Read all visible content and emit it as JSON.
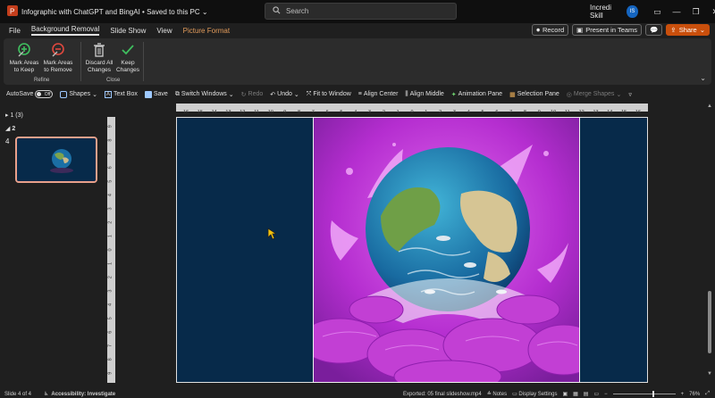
{
  "titlebar": {
    "doc_title": "Infographic with ChatGPT and BingAI",
    "save_state": "Saved to this PC",
    "search_placeholder": "Search",
    "user_name": "Incredi Skill",
    "user_initials": "IS"
  },
  "tabs": [
    {
      "label": "File"
    },
    {
      "label": "Background Removal"
    },
    {
      "label": "Slide Show"
    },
    {
      "label": "View"
    },
    {
      "label": "Picture Format"
    }
  ],
  "tab_actions": {
    "record": "Record",
    "present": "Present in Teams",
    "share": "Share"
  },
  "ribbon": {
    "mark_keep": "Mark Areas to Keep",
    "mark_remove": "Mark Areas to Remove",
    "refine_label": "Refine",
    "discard": "Discard All Changes",
    "keep_changes": "Keep Changes",
    "close_label": "Close"
  },
  "qat": {
    "autosave": "AutoSave",
    "autosave_state": "Off",
    "shapes": "Shapes",
    "text_box": "Text Box",
    "save": "Save",
    "switch_windows": "Switch Windows",
    "redo": "Redo",
    "undo": "Undo",
    "fit_window": "Fit to Window",
    "align_center": "Align Center",
    "align_middle": "Align Middle",
    "animation_pane": "Animation Pane",
    "selection_pane": "Selection Pane",
    "merge_shapes": "Merge Shapes"
  },
  "outline": {
    "section1": "1 (3)",
    "section2": "2",
    "thumb_number": "4"
  },
  "ruler": {
    "h_ticks": [
      "16",
      "15",
      "14",
      "13",
      "12",
      "11",
      "10",
      "9",
      "8",
      "7",
      "6",
      "5",
      "4",
      "3",
      "2",
      "1",
      "0",
      "1",
      "2",
      "3",
      "4",
      "5",
      "6",
      "7",
      "8",
      "9",
      "10",
      "11",
      "12",
      "13",
      "14",
      "15",
      "16"
    ],
    "v_ticks": [
      "9",
      "8",
      "7",
      "6",
      "5",
      "4",
      "3",
      "2",
      "1",
      "0",
      "1",
      "2",
      "3",
      "4",
      "5",
      "6",
      "7",
      "8",
      "9"
    ]
  },
  "status": {
    "slide_info": "Slide 4 of 4",
    "accessibility": "Accessibility: Investigate",
    "exported": "Exported: 05 final slideshow.mp4",
    "notes": "Notes",
    "display": "Display Settings",
    "zoom": "76%"
  },
  "colors": {
    "accent": "#c94f0c",
    "slide_bg": "#072a4a",
    "magenta": "#b02ccf",
    "selection_outline": "#e9a08b"
  }
}
